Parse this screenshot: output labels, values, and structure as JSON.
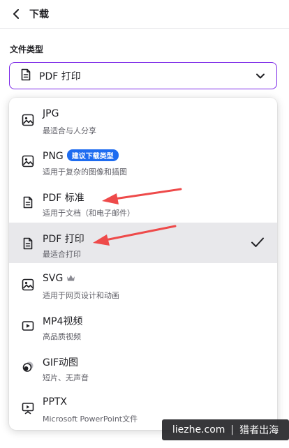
{
  "header": {
    "title": "下载"
  },
  "file_type": {
    "label": "文件类型",
    "selected": "PDF 打印"
  },
  "menu": {
    "items": [
      {
        "name": "JPG",
        "desc": "最适合与人分享",
        "icon": "image-icon"
      },
      {
        "name": "PNG",
        "badge": "建议下载类型",
        "desc": "适用于复杂的图像和插图",
        "icon": "image-icon"
      },
      {
        "name": "PDF 标准",
        "desc": "适用于文档（和电子邮件）",
        "icon": "document-icon"
      },
      {
        "name": "PDF 打印",
        "desc": "最适合打印",
        "icon": "document-icon",
        "selected": true
      },
      {
        "name": "SVG",
        "desc": "适用于网页设计和动画",
        "icon": "image-icon",
        "premium": true
      },
      {
        "name": "MP4视频",
        "desc": "高品质视频",
        "icon": "video-icon"
      },
      {
        "name": "GIF动图",
        "desc": "短片、无声音",
        "icon": "gif-icon"
      },
      {
        "name": "PPTX",
        "desc": "Microsoft PowerPoint文件",
        "icon": "presentation-icon"
      }
    ]
  },
  "watermark": {
    "site": "liezhe.com",
    "brand": "猎者出海"
  },
  "colors": {
    "accent": "#7d2ae8",
    "badge": "#1e6cf0",
    "arrow": "#ee4a4a",
    "selected_bg": "#e8e8eb"
  }
}
